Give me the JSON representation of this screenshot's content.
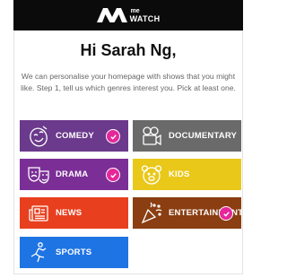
{
  "brand": {
    "me": "me",
    "watch": "WATCH"
  },
  "greeting": "Hi Sarah Ng,",
  "intro": "We can personalise your homepage with shows that you might like. Step 1, tell us which genres interest you. Pick at least one.",
  "genres": [
    {
      "label": "COMEDY",
      "icon": "comedy-mask-icon",
      "color": "#6b3a8c",
      "selected": true
    },
    {
      "label": "DOCUMENTARY",
      "icon": "film-camera-icon",
      "color": "#6a6a6a",
      "selected": false
    },
    {
      "label": "DRAMA",
      "icon": "drama-masks-icon",
      "color": "#7b2f96",
      "selected": true
    },
    {
      "label": "KIDS",
      "icon": "teddy-bear-icon",
      "color": "#e9c81a",
      "selected": false
    },
    {
      "label": "NEWS",
      "icon": "newspaper-icon",
      "color": "#e8401f",
      "selected": false
    },
    {
      "label": "ENTERTAINMENT",
      "icon": "party-popper-icon",
      "color": "#8a3e12",
      "selected": true
    },
    {
      "label": "SPORTS",
      "icon": "runner-icon",
      "color": "#1f74e3",
      "selected": false
    }
  ],
  "colors": {
    "check": "#e5279a",
    "topbar": "#0b0b0b"
  }
}
